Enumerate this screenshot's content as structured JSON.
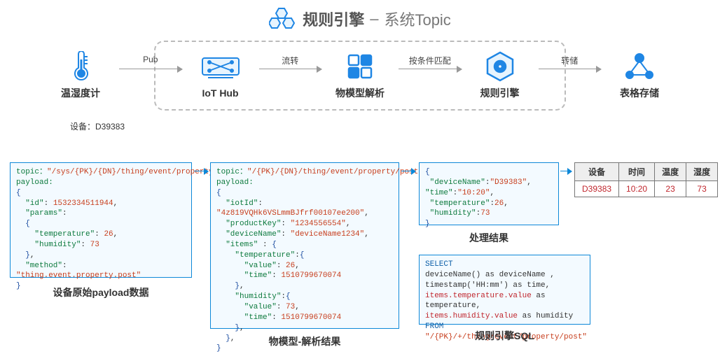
{
  "title": {
    "main": "规则引擎",
    "dash": "–",
    "sub": "系统Topic"
  },
  "flow": {
    "nodes": {
      "sensor": "温湿度计",
      "hub": "IoT Hub",
      "parse": "物模型解析",
      "engine": "规则引擎",
      "store": "表格存储"
    },
    "arrows": {
      "pub": "Pub",
      "route": "流转",
      "match": "按条件匹配",
      "save": "转储"
    }
  },
  "deviceAnnotation": "设备：D39383",
  "panel1": {
    "caption": "设备原始payload数据",
    "topic_label": "topic：",
    "topic": "\"/sys/{PK}/{DN}/thing/event/property/post\"",
    "payload_label": "payload:",
    "id_key": "\"id\"",
    "id_val": "1532334511944",
    "params_key": "\"params\"",
    "temp_key": "\"temperature\"",
    "temp_val": "26",
    "hum_key": "\"humidity\"",
    "hum_val": "73",
    "method_key": "\"method\"",
    "method_val": "\"thing.event.property.post\""
  },
  "panel2": {
    "caption": "物模型-解析结果",
    "topic_label": "topic：",
    "topic": "\"/{PK}/{DN}/thing/event/property/post\"",
    "payload_label": "payload:",
    "iotid_key": "\"iotId\"",
    "iotid_val": "\"4z819VQHk6VSLmmBJfrf00107ee200\"",
    "pk_key": "\"productKey\"",
    "pk_val": "\"1234556554\"",
    "dn_key": "\"deviceName\"",
    "dn_val": "\"deviceName1234\"",
    "items_key": "\"items\"",
    "temp_key": "\"temperature\"",
    "val_key": "\"value\"",
    "temp_val": "26",
    "time_key": "\"time\"",
    "temp_time": "1510799670074",
    "hum_key": "\"humidity\"",
    "hum_val": "73",
    "hum_time": "1510799670074"
  },
  "panel3": {
    "caption": "处理结果",
    "dn_key": "\"deviceName\"",
    "dn_val": "\"D39383\"",
    "time_key": "\"time\"",
    "time_val": "\"10:20\"",
    "temp_key": "\"temperature\"",
    "temp_val": "26",
    "hum_key": "\"humidity\"",
    "hum_val": "73"
  },
  "panel4": {
    "caption": "规则引擎SQL",
    "l1": "SELECT",
    "l2a": "deviceName() as deviceName ,",
    "l3a": "timestamp('HH:mm') as time,",
    "l4a": "items.temperature.value",
    "l4b": " as temperature,",
    "l5a": "items.humidity.value",
    "l5b": " as humidity",
    "l6a": "FROM ",
    "l6b": "\"/{PK}/+/thing/event/property/post\""
  },
  "table": {
    "headers": [
      "设备",
      "时间",
      "温度",
      "湿度"
    ],
    "row": [
      "D39383",
      "10:20",
      "23",
      "73"
    ]
  }
}
